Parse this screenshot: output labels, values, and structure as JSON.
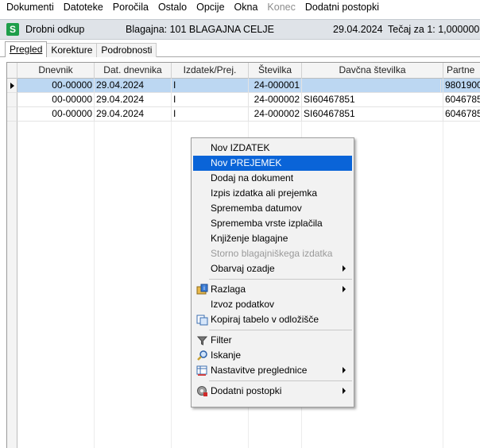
{
  "menubar": {
    "items": [
      "Dokumenti",
      "Datoteke",
      "Poročila",
      "Ostalo",
      "Opcije",
      "Okna",
      "Konec",
      "Dodatni postopki"
    ],
    "disabled_item": "Konec"
  },
  "window": {
    "title": "Drobni odkup",
    "register": "Blagajna: 101  BLAGAJNA CELJE",
    "date": "29.04.2024",
    "rate": "Tečaj za 1: 1,000000"
  },
  "tabs": [
    "Pregled",
    "Korekture",
    "Podrobnosti"
  ],
  "grid": {
    "columns": [
      "Dnevnik",
      "Dat. dnevnika",
      "Izdatek/Prej.",
      "Številka",
      "Davčna številka",
      "Partne"
    ],
    "rows": [
      {
        "dnevnik": "00-00000",
        "datum": "29.04.2024",
        "izdatek": "I",
        "stevilka": "24-000001",
        "davcna": "",
        "partner": "9801900"
      },
      {
        "dnevnik": "00-00000",
        "datum": "29.04.2024",
        "izdatek": "I",
        "stevilka": "24-000002",
        "davcna": "SI60467851",
        "partner": "6046785"
      },
      {
        "dnevnik": "00-00000",
        "datum": "29.04.2024",
        "izdatek": "I",
        "stevilka": "24-000002",
        "davcna": "SI60467851",
        "partner": "6046785"
      }
    ]
  },
  "context_menu": {
    "items": [
      {
        "label": "Nov IZDATEK"
      },
      {
        "label": "Nov PREJEMEK",
        "highlighted": true
      },
      {
        "label": "Dodaj na dokument"
      },
      {
        "label": "Izpis izdatka ali prejemka"
      },
      {
        "label": "Sprememba datumov"
      },
      {
        "label": "Sprememba vrste izplačila"
      },
      {
        "label": "Knjiženje blagajne"
      },
      {
        "label": "Storno blagajniškega izdatka",
        "disabled": true
      },
      {
        "label": "Obarvaj ozadje",
        "submenu": true
      },
      {
        "label": "Razlaga",
        "submenu": true,
        "icon": "folder-info-icon"
      },
      {
        "label": "Izvoz podatkov"
      },
      {
        "label": "Kopiraj tabelo v odložišče",
        "icon": "copy-table-icon"
      },
      {
        "label": "Filter",
        "icon": "filter-icon"
      },
      {
        "label": "Iskanje",
        "icon": "search-icon"
      },
      {
        "label": "Nastavitve preglednice",
        "submenu": true,
        "icon": "table-settings-icon"
      },
      {
        "label": "Dodatni postopki",
        "submenu": true,
        "icon": "gear-icon"
      }
    ]
  },
  "colors": {
    "selection": "#0a64d8",
    "row_selected": "#bcd7f2",
    "app_icon": "#1e9e4a"
  }
}
